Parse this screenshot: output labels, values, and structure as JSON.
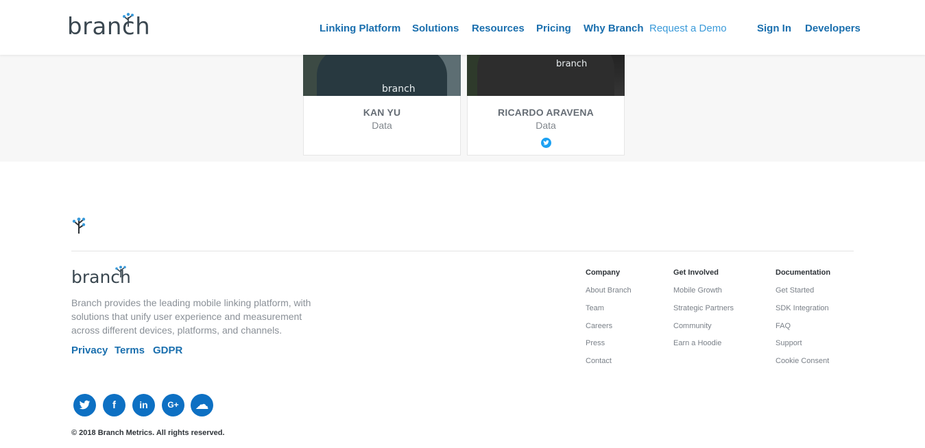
{
  "header": {
    "logo_text": "branch",
    "nav": [
      {
        "label": "Linking Platform"
      },
      {
        "label": "Solutions"
      },
      {
        "label": "Resources"
      },
      {
        "label": "Pricing"
      },
      {
        "label": "Why Branch"
      },
      {
        "label": "Request a Demo"
      },
      {
        "label": "Sign In"
      },
      {
        "label": "Developers"
      }
    ]
  },
  "team": {
    "members": [
      {
        "name": "KAN YU",
        "role": "Data",
        "photo_text": "branch"
      },
      {
        "name": "RICARDO ARAVENA",
        "role": "Data",
        "photo_text": "branch",
        "social_icon": "twitter-icon"
      }
    ]
  },
  "footer": {
    "tree_icon": "branch-tree-icon",
    "logo_text": "branch",
    "description": "Branch provides the leading mobile linking platform, with solutions that unify user experience and measurement across different devices, platforms, and channels.",
    "links": [
      {
        "label": "Privacy"
      },
      {
        "label": "Terms"
      },
      {
        "label": "GDPR"
      }
    ],
    "columns": [
      {
        "title": "Company",
        "items": [
          "About Branch",
          "Team",
          "Careers",
          "Press",
          "Contact"
        ]
      },
      {
        "title": "Get Involved",
        "items": [
          "Mobile Growth",
          "Strategic Partners",
          "Community",
          "Earn a Hoodie"
        ]
      },
      {
        "title": "Documentation",
        "items": [
          "Get Started",
          "SDK Integration",
          "FAQ",
          "Support",
          "Cookie Consent"
        ]
      }
    ],
    "social": [
      {
        "icon": "twitter-icon",
        "glyph": "🐦"
      },
      {
        "icon": "facebook-icon",
        "glyph": "f"
      },
      {
        "icon": "linkedin-icon",
        "glyph": "in"
      },
      {
        "icon": "google-plus-icon",
        "glyph": "G+"
      },
      {
        "icon": "soundcloud-icon",
        "glyph": "☁"
      }
    ],
    "copyright": "© 2018 Branch Metrics. All rights reserved."
  },
  "colors": {
    "brand_blue": "#1a6fae",
    "demo_blue": "#3a9ad9",
    "social_blue": "#0d70c3",
    "twitter_blue": "#1da1f2"
  }
}
